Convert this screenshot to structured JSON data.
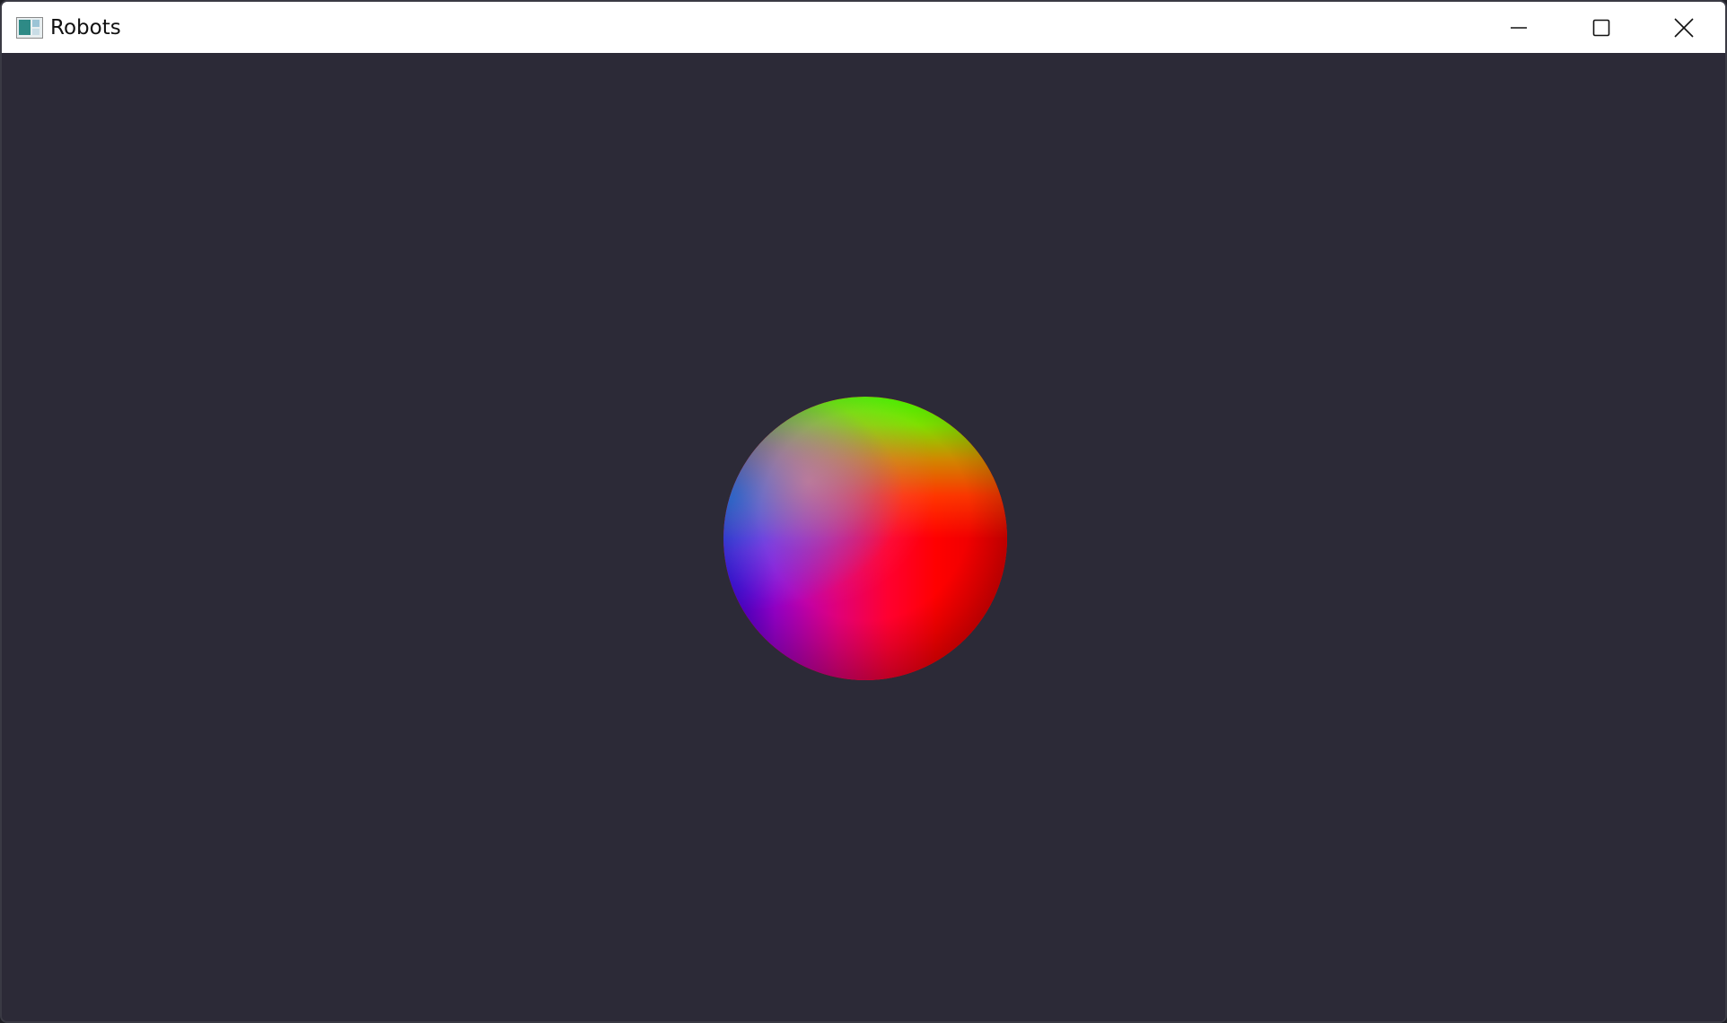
{
  "window": {
    "title": "Robots",
    "icon": "app-window-icon",
    "controls": [
      "minimize-icon",
      "maximize-icon",
      "close-icon"
    ]
  },
  "viewport": {
    "background_color": "#2c2a37",
    "object": "sphere",
    "sphere_colors": {
      "top": "#4bff00",
      "left": "#3a00ff",
      "center": "#e0007a",
      "right": "#ff0000"
    }
  }
}
